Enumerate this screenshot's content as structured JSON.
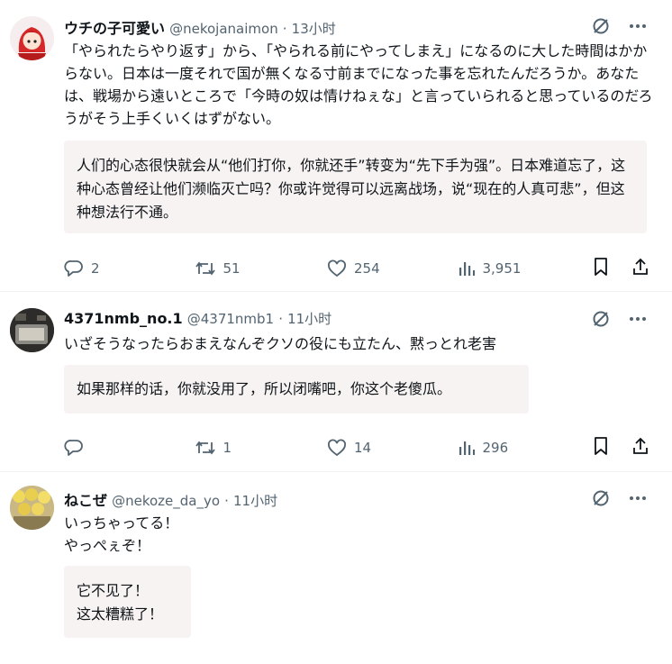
{
  "tweets": [
    {
      "name": "ウチの子可愛い",
      "handle": "@nekojanaimon",
      "time": "13小时",
      "text": "「やられたらやり返す」から、「やられる前にやってしまえ」になるのに大した時間はかからない。日本は一度それで国が無くなる寸前までになった事を忘れたんだろうか。あなたは、戦場から遠いところで「今時の奴は情けねぇな」と言っていられると思っているのだろうがそう上手くいくはずがない。",
      "translation": "人们的心态很快就会从“他们打你，你就还手”转变为“先下手为强”。日本难道忘了，这种心态曾经让他们濒临灭亡吗？你或许觉得可以远离战场，说“现在的人真可悲”，但这种想法行不通。",
      "replies": "2",
      "retweets": "51",
      "likes": "254",
      "views": "3,951"
    },
    {
      "name": "4371nmb_no.1",
      "handle": "@4371nmb1",
      "time": "11小时",
      "text": "いざそうなったらおまえなんぞクソの役にも立たん、黙っとれ老害",
      "translation": "如果那样的话，你就没用了，所以闭嘴吧，你这个老傻瓜。",
      "replies": "",
      "retweets": "1",
      "likes": "14",
      "views": "296"
    },
    {
      "name": "ねこぜ",
      "handle": "@nekoze_da_yo",
      "time": "11小时",
      "text_line1": "いっちゃってる！",
      "text_line2": "やっぺぇぞ！",
      "translation_line1": "它不见了！",
      "translation_line2": "这太糟糕了！"
    }
  ],
  "icons": [
    "grok-icon",
    "more-icon",
    "reply-icon",
    "retweet-icon",
    "like-icon",
    "views-icon",
    "bookmark-icon",
    "share-icon"
  ],
  "colors": {
    "text": "#0f1419",
    "secondary": "#536471",
    "translation_bg": "#f7f3f2",
    "divider": "#eff3f4"
  }
}
